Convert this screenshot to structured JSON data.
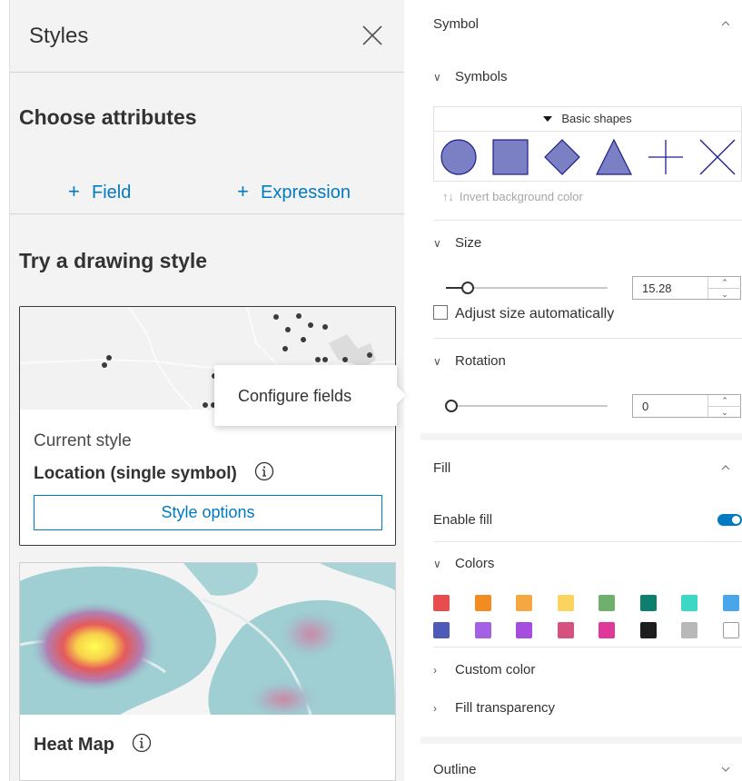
{
  "left_panel": {
    "title": "Styles",
    "choose_heading": "Choose attributes",
    "add_field_label": "Field",
    "add_expression_label": "Expression",
    "try_heading": "Try a drawing style",
    "current_card": {
      "current_label": "Current style",
      "style_name": "Location (single symbol)",
      "options_button": "Style options"
    },
    "tooltip": "Configure fields",
    "heat_card": {
      "style_name": "Heat Map"
    }
  },
  "right_panel": {
    "symbol": {
      "heading": "Symbol",
      "symbols_heading": "Symbols",
      "shape_set": "Basic shapes",
      "shapes": [
        "circle-icon",
        "square-icon",
        "diamond-icon",
        "triangle-icon",
        "plus-icon",
        "x-icon"
      ],
      "symbol_color": "#7b7fc4",
      "symbol_stroke": "#1e1e8c",
      "invert_label": "Invert background color",
      "size_heading": "Size",
      "size_value": "15.28",
      "size_slider_fraction": 0.07,
      "adjust_size_label": "Adjust size automatically",
      "rotation_heading": "Rotation",
      "rotation_value": "0",
      "rotation_slider_fraction": 0
    },
    "fill": {
      "heading": "Fill",
      "enable_fill_label": "Enable fill",
      "enable_fill": true,
      "colors_heading": "Colors",
      "colors": [
        "#e84c4c",
        "#f28c1e",
        "#f5a742",
        "#fbd460",
        "#6fb06a",
        "#0d7f6e",
        "#3cd8c5",
        "#4aa6ea",
        "#4d5ab8",
        "#a262e3",
        "#a64de0",
        "#d5527f",
        "#e0379b",
        "#1d1d1d",
        "#b8b8b8",
        "#ffffff"
      ],
      "custom_color_label": "Custom color",
      "fill_transparency_label": "Fill transparency"
    },
    "outline": {
      "heading": "Outline"
    }
  },
  "accent_color": "#007ac2"
}
